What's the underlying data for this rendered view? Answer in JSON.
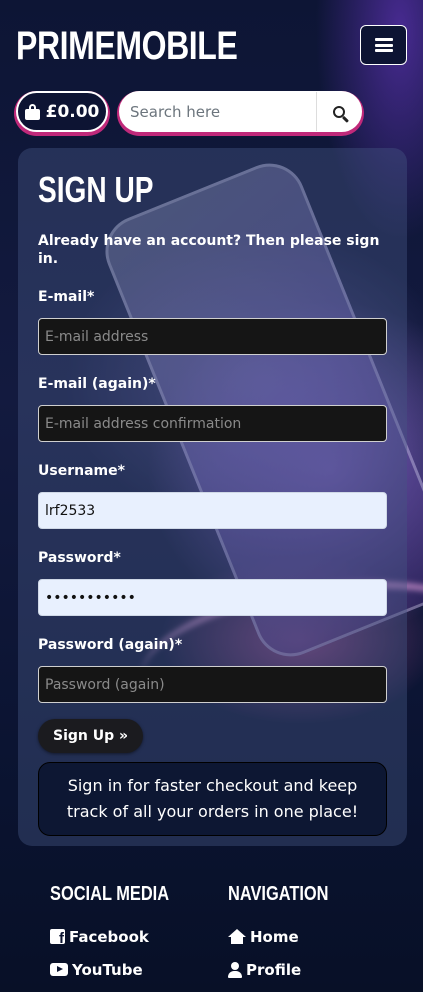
{
  "header": {
    "brand": "PRIMEMOBILE",
    "bag_total": "£0.00",
    "search_placeholder": "Search here",
    "menu_icon": "hamburger-icon",
    "bag_icon": "shopping-bag-icon",
    "search_icon": "search-icon"
  },
  "signup": {
    "title": "SIGN UP",
    "lead": "Already have an account? Then please sign in.",
    "fields": [
      {
        "label": "E-mail*",
        "value": "",
        "placeholder": "E-mail address",
        "type": "email"
      },
      {
        "label": "E-mail (again)*",
        "value": "",
        "placeholder": "E-mail address confirmation",
        "type": "email"
      },
      {
        "label": "Username*",
        "value": "lrf2533",
        "placeholder": "",
        "type": "text"
      },
      {
        "label": "Password*",
        "value": "•••••••••••",
        "placeholder": "",
        "type": "password"
      },
      {
        "label": "Password (again)*",
        "value": "",
        "placeholder": "Password (again)",
        "type": "password"
      }
    ],
    "button": "Sign Up »",
    "note": "Sign in for faster checkout and keep track of all your orders in one place!"
  },
  "footer": {
    "social": {
      "heading": "SOCIAL MEDIA",
      "links": [
        {
          "label": "Facebook",
          "icon": "facebook-icon"
        },
        {
          "label": "YouTube",
          "icon": "youtube-icon"
        }
      ]
    },
    "navigation": {
      "heading": "NAVIGATION",
      "links": [
        {
          "label": "Home",
          "icon": "home-icon"
        },
        {
          "label": "Profile",
          "icon": "user-icon"
        }
      ]
    }
  },
  "colors": {
    "background": "#0b1430",
    "accent": "#c0297a",
    "card": "#46558277",
    "input_dark": "#151515",
    "input_autofill": "#e8f0fe"
  }
}
